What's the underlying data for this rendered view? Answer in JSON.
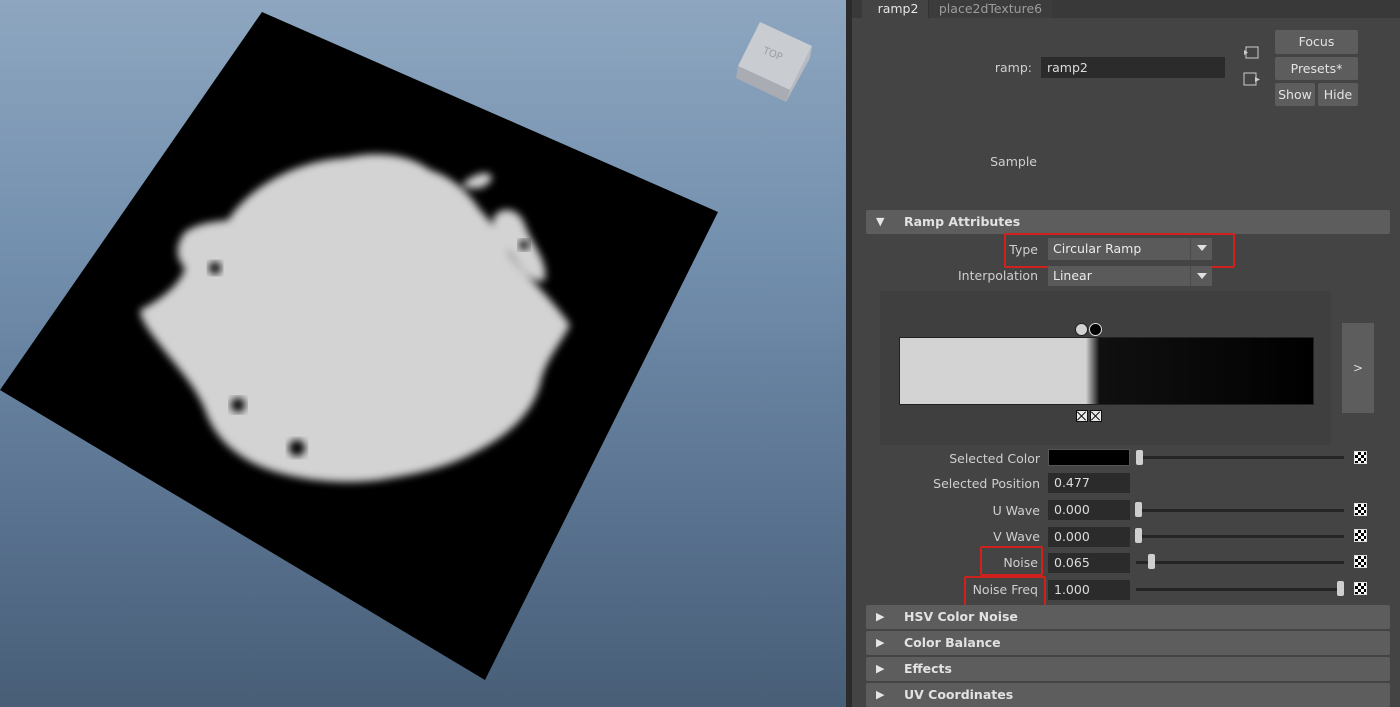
{
  "viewport": {
    "cube_label": "TOP"
  },
  "editor": {
    "tabs": [
      "ramp2",
      "place2dTexture6"
    ],
    "node_label": "ramp:",
    "node_value": "ramp2",
    "buttons": {
      "focus": "Focus",
      "presets": "Presets*",
      "show": "Show",
      "hide": "Hide"
    },
    "sample_label": "Sample"
  },
  "ramp_attributes": {
    "title": "Ramp Attributes",
    "type_label": "Type",
    "type_value": "Circular Ramp",
    "interpolation_label": "Interpolation",
    "interpolation_value": "Linear",
    "expand_label": ">",
    "selected_position": 0.477,
    "fields": {
      "selected_color_label": "Selected Color",
      "selected_position_label": "Selected Position",
      "selected_position_value": "0.477",
      "u_wave_label": "U Wave",
      "u_wave_value": "0.000",
      "v_wave_label": "V Wave",
      "v_wave_value": "0.000",
      "noise_label": "Noise",
      "noise_value": "0.065",
      "noise_freq_label": "Noise Freq",
      "noise_freq_value": "1.000"
    }
  },
  "sections": [
    "HSV Color Noise",
    "Color Balance",
    "Effects",
    "UV Coordinates"
  ],
  "colors": {
    "highlight": "#d0211c",
    "panel": "#444444",
    "section": "#5d5d5d"
  }
}
